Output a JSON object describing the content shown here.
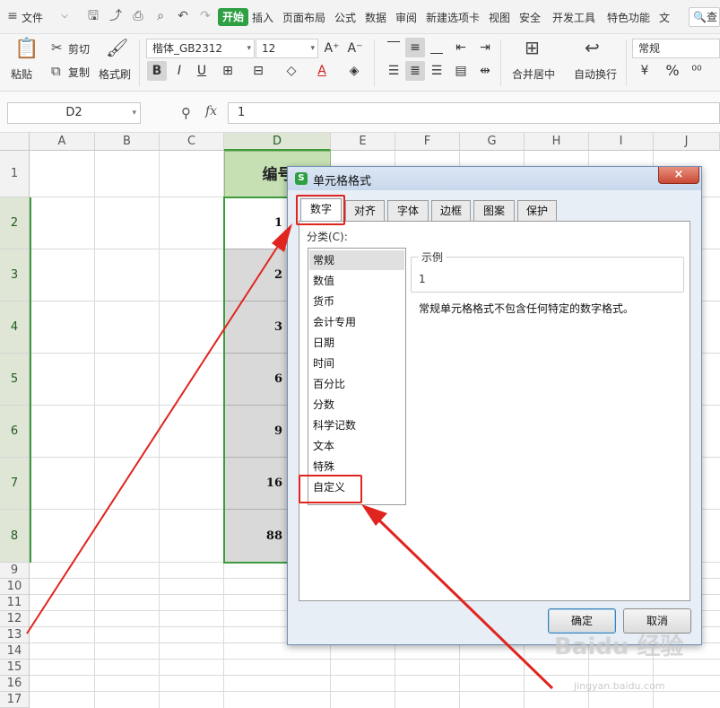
{
  "menu": {
    "file": "文件",
    "tabs": [
      "开始",
      "插入",
      "页面布局",
      "公式",
      "数据",
      "审阅",
      "新建选项卡",
      "视图",
      "安全",
      "开发工具",
      "特色功能"
    ],
    "more": "文 查"
  },
  "ribbon": {
    "paste": "粘贴",
    "cut": "剪切",
    "copy": "复制",
    "format_painter": "格式刷",
    "font_name": "楷体_GB2312",
    "font_size": "12",
    "merge_center": "合并居中",
    "wrap_text": "自动换行",
    "number_format": "常规",
    "percent": "%"
  },
  "formula_bar": {
    "name_box": "D2",
    "fx": "fx",
    "value": "1"
  },
  "grid": {
    "columns": [
      "A",
      "B",
      "C",
      "D",
      "E",
      "F",
      "G",
      "H",
      "I",
      "J"
    ],
    "rows": [
      "1",
      "2",
      "3",
      "4",
      "5",
      "6",
      "7",
      "8",
      "9",
      "10",
      "11",
      "12",
      "13",
      "14",
      "15",
      "16",
      "17"
    ],
    "d_header": "编号",
    "d_values": [
      "1",
      "2",
      "3",
      "6",
      "9",
      "16",
      "88"
    ]
  },
  "dialog": {
    "title": "单元格格式",
    "close": "×",
    "tabs": [
      "数字",
      "对齐",
      "字体",
      "边框",
      "图案",
      "保护"
    ],
    "category_label": "分类(C):",
    "categories": [
      "常规",
      "数值",
      "货币",
      "会计专用",
      "日期",
      "时间",
      "百分比",
      "分数",
      "科学记数",
      "文本",
      "特殊",
      "自定义"
    ],
    "sample_label": "示例",
    "sample_value": "1",
    "description": "常规单元格格式不包含任何特定的数字格式。",
    "ok": "确定",
    "cancel": "取消"
  },
  "watermark": {
    "text": "Baidu 经验",
    "url": "jingyan.baidu.com"
  },
  "colors": {
    "accent_green": "#2ea043",
    "selection_green": "#3d9b3d",
    "annotation_red": "#e0241f",
    "header_fill": "#c6e0b4",
    "cell_fill": "#d9d9d9"
  }
}
